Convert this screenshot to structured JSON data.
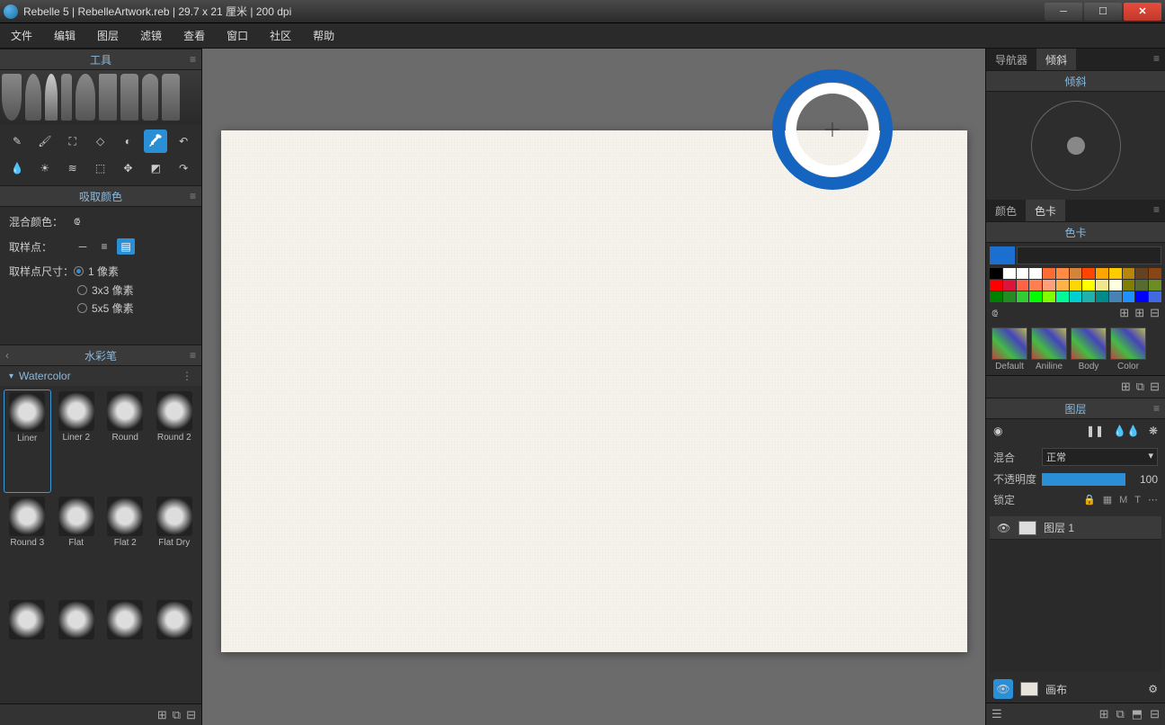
{
  "titlebar": {
    "app": "Rebelle 5",
    "file": "RebelleArtwork.reb",
    "dims": "29.7 x 21 厘米",
    "dpi": "200 dpi"
  },
  "menu": [
    "文件",
    "编辑",
    "图层",
    "滤镜",
    "查看",
    "窗口",
    "社区",
    "帮助"
  ],
  "panels": {
    "tools": "工具",
    "pickcolor": "吸取颜色",
    "brush": "水彩笔",
    "navigator": "导航器",
    "tilt": "倾斜",
    "color": "颜色",
    "swatches": "色卡",
    "layers": "图层"
  },
  "props": {
    "mix_label": "混合颜色：",
    "sample_label": "取样点：",
    "size_label": "取样点尺寸：",
    "opt1": "1 像素",
    "opt3": "3x3 像素",
    "opt5": "5x5 像素"
  },
  "brushes": {
    "category": "Watercolor",
    "presets": [
      "Liner",
      "Liner 2",
      "Round",
      "Round 2",
      "Round 3",
      "Flat",
      "Flat 2",
      "Flat Dry",
      "",
      "",
      "",
      ""
    ]
  },
  "palettes": [
    "Default",
    "Aniline",
    "Body",
    "Color"
  ],
  "layer": {
    "blend_label": "混合",
    "blend_value": "正常",
    "opacity_label": "不透明度",
    "opacity_value": "100",
    "lock_label": "锁定",
    "lock_opts": [
      "M",
      "T"
    ],
    "layer1": "图层 1",
    "canvas_label": "画布"
  },
  "swatch_colors": [
    "#000000",
    "#ffffff",
    "#ffffff",
    "#ffffff",
    "#ff6b35",
    "#ff8c42",
    "#d68438",
    "#ff4500",
    "#ffa500",
    "#ffcc00",
    "#b8860b",
    "#654321",
    "#8b4513",
    "#ff0000",
    "#dc143c",
    "#ff6347",
    "#ff7f50",
    "#ffa07a",
    "#ffb347",
    "#ffd700",
    "#ffff00",
    "#f0e68c",
    "#ffffe0",
    "#808000",
    "#556b2f",
    "#6b8e23",
    "#008000",
    "#228b22",
    "#32cd32",
    "#00ff00",
    "#7fff00",
    "#00fa9a",
    "#00ced1",
    "#20b2aa",
    "#008b8b",
    "#4682b4",
    "#1e90ff",
    "#0000ff",
    "#4169e1"
  ]
}
